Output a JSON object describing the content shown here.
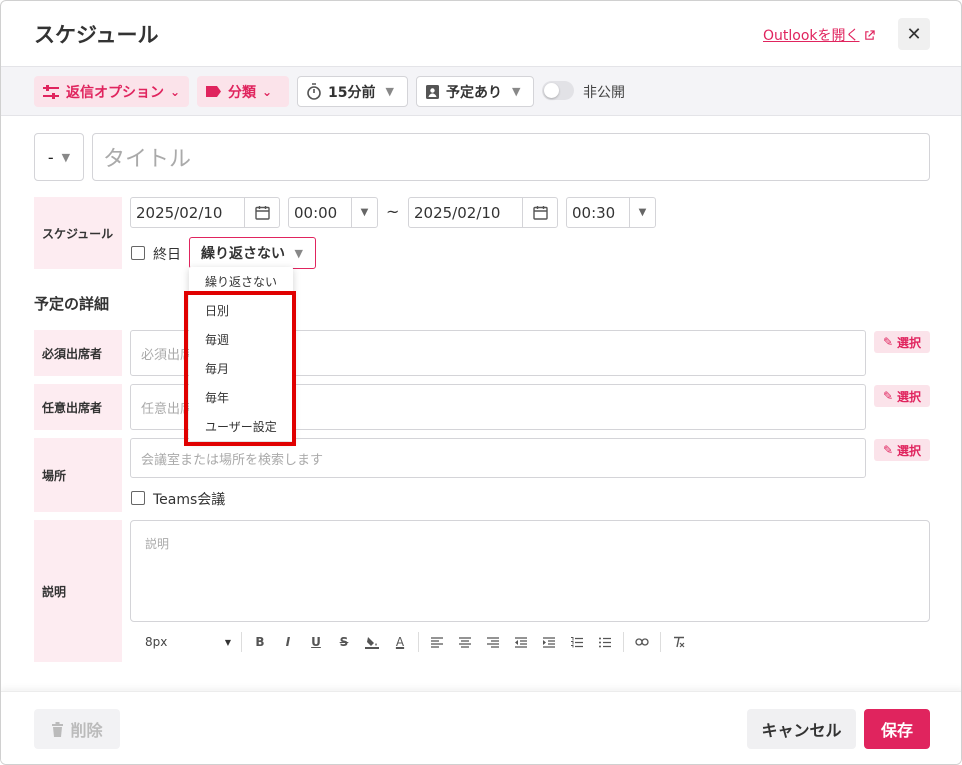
{
  "dialog": {
    "title": "スケジュール",
    "outlook_link": "Outlookを開く",
    "close_glyph": "✕"
  },
  "toolbar": {
    "reply_options": "返信オプション",
    "category": "分類",
    "reminder": "15分前",
    "show_as": "予定あり",
    "private_label": "非公開",
    "private_on": false
  },
  "form": {
    "priority_value": "-",
    "title_placeholder": "タイトル",
    "schedule_label": "スケジュール",
    "start_date": "2025/02/10",
    "start_time": "00:00",
    "tilde": "~",
    "end_date": "2025/02/10",
    "end_time": "00:30",
    "all_day_label": "終日",
    "repeat_value": "繰り返さない",
    "details_title": "予定の詳細",
    "required_label": "必須出席者",
    "required_placeholder": "必須出席者",
    "optional_label": "任意出席者",
    "optional_placeholder": "任意出席者",
    "location_label": "場所",
    "location_placeholder": "会議室または場所を検索します",
    "teams_label": "Teams会議",
    "description_label": "説明",
    "description_placeholder": "説明",
    "select_label": "選択",
    "font_size": "8px"
  },
  "repeat_menu": {
    "items": [
      "繰り返さない",
      "日別",
      "毎週",
      "毎月",
      "毎年",
      "ユーザー設定"
    ],
    "highlight_color": "#e00000"
  },
  "footer": {
    "delete_label": "削除",
    "cancel_label": "キャンセル",
    "save_label": "保存"
  },
  "colors": {
    "accent": "#e0245e",
    "accent_light": "#fbe3ea",
    "label_bg": "#fdecf1"
  }
}
